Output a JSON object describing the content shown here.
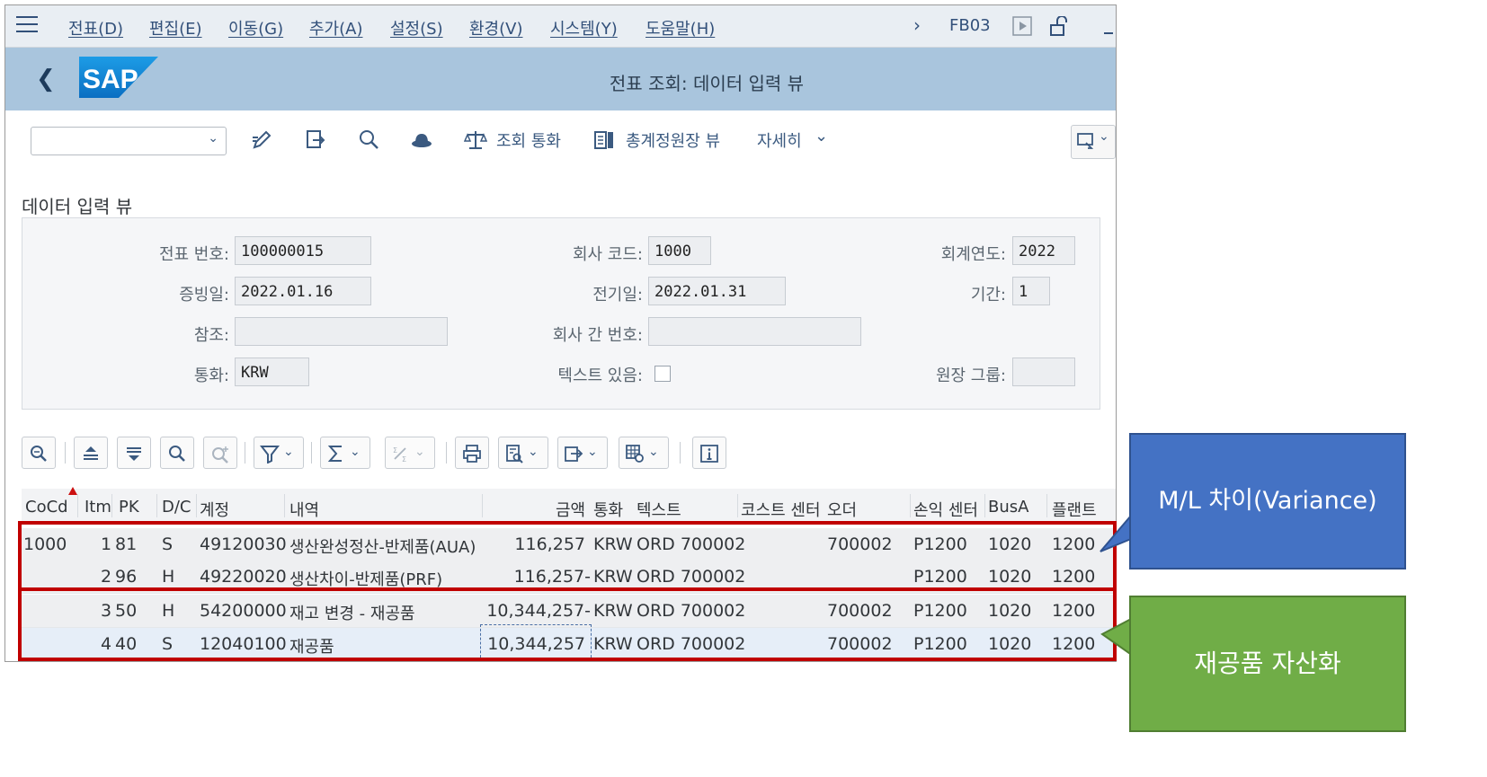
{
  "menu": {
    "items": [
      "전표(D)",
      "편집(E)",
      "이동(G)",
      "추가(A)",
      "설정(S)",
      "환경(V)",
      "시스템(Y)",
      "도움말(H)"
    ],
    "tcode": "FB03"
  },
  "titlebar": {
    "title": "전표 조회: 데이터 입력 뷰"
  },
  "toolbar": {
    "currency_btn": "조회 통화",
    "gl_view_btn": "총계정원장 뷰",
    "more_btn": "자세히"
  },
  "section": {
    "title": "데이터 입력 뷰"
  },
  "form": {
    "doc_no_label": "전표 번호:",
    "doc_no": "100000015",
    "company_label": "회사 코드:",
    "company": "1000",
    "fiscal_year_label": "회계연도:",
    "fiscal_year": "2022",
    "doc_date_label": "증빙일:",
    "doc_date": "2022.01.16",
    "posting_date_label": "전기일:",
    "posting_date": "2022.01.31",
    "period_label": "기간:",
    "period": "1",
    "reference_label": "참조:",
    "reference": "",
    "intercompany_label": "회사 간 번호:",
    "intercompany": "",
    "currency_label": "통화:",
    "currency": "KRW",
    "text_exists_label": "텍스트 있음:",
    "ledger_group_label": "원장 그룹:",
    "ledger_group": ""
  },
  "table": {
    "headers": [
      "CoCd",
      "Itm",
      "PK",
      "D/C",
      "계정",
      "내역",
      "금액",
      "통화",
      "텍스트",
      "코스트 센터",
      "오더",
      "손익 센터",
      "BusA",
      "플랜트"
    ],
    "rows": [
      {
        "cocd": "1000",
        "itm": "1",
        "pk": "81",
        "dc": "S",
        "account": "49120030",
        "desc": "생산완성정산-반제품(AUA)",
        "amount": "116,257",
        "curr": "KRW",
        "text": "ORD 700002",
        "cc": "",
        "order": "700002",
        "pc": "P1200",
        "busa": "1020",
        "plant": "1200"
      },
      {
        "cocd": "",
        "itm": "2",
        "pk": "96",
        "dc": "H",
        "account": "49220020",
        "desc": "생산차이-반제품(PRF)",
        "amount": "116,257-",
        "curr": "KRW",
        "text": "ORD 700002",
        "cc": "",
        "order": "",
        "pc": "P1200",
        "busa": "1020",
        "plant": "1200"
      },
      {
        "cocd": "",
        "itm": "3",
        "pk": "50",
        "dc": "H",
        "account": "54200000",
        "desc": "재고 변경 - 재공품",
        "amount": "10,344,257-",
        "curr": "KRW",
        "text": "ORD 700002",
        "cc": "",
        "order": "700002",
        "pc": "P1200",
        "busa": "1020",
        "plant": "1200"
      },
      {
        "cocd": "",
        "itm": "4",
        "pk": "40",
        "dc": "S",
        "account": "12040100",
        "desc": "재공품",
        "amount": "10,344,257",
        "curr": "KRW",
        "text": "ORD 700002",
        "cc": "",
        "order": "700002",
        "pc": "P1200",
        "busa": "1020",
        "plant": "1200"
      }
    ]
  },
  "callouts": {
    "variance": "M/L 차이(Variance)",
    "wip": "재공품 자산화"
  },
  "colors": {
    "title_bar": "#a9c5dd",
    "menu_bar": "#e9eef3",
    "highlight": "#c00000",
    "callout_blue": "#4472c4",
    "callout_green": "#70ad47"
  }
}
